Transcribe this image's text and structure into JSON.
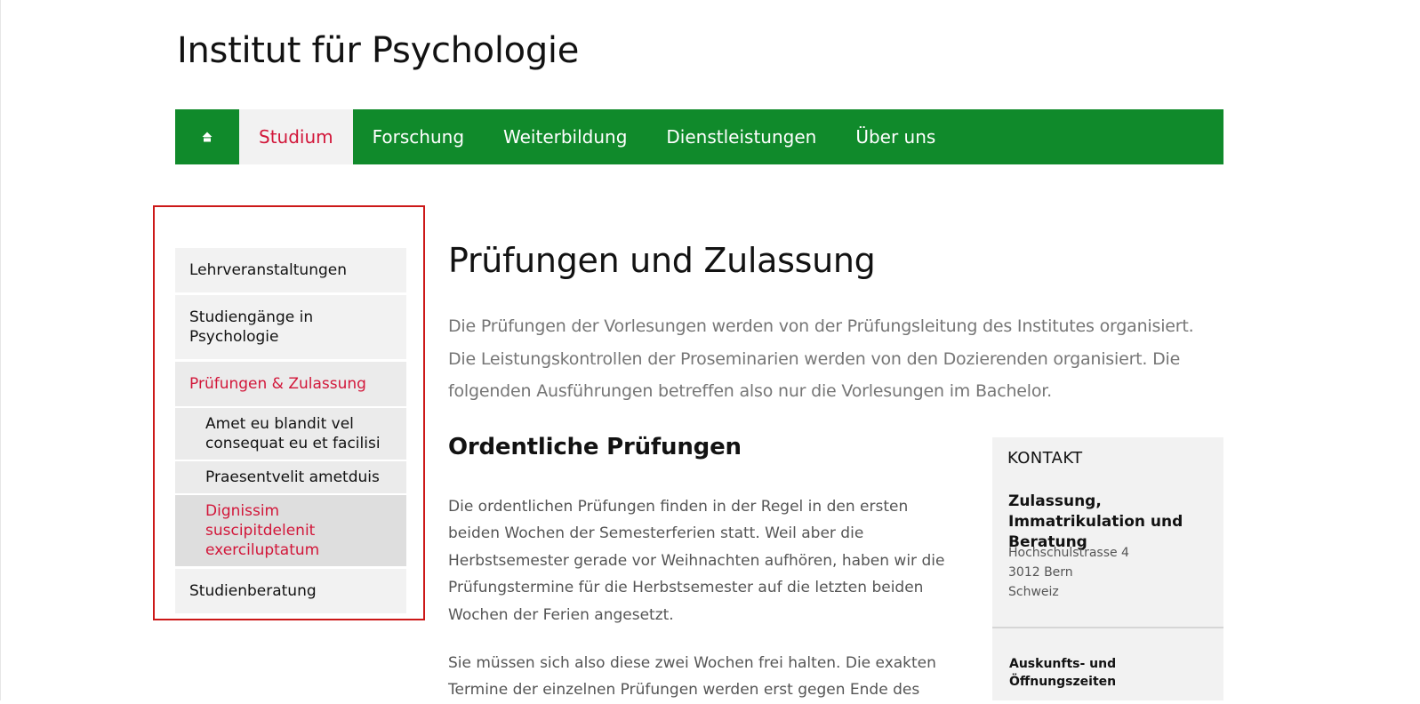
{
  "site": {
    "title": "Institut für Psychologie"
  },
  "main_nav": {
    "home_icon": "home-icon",
    "items": [
      {
        "label": "Studium",
        "active": true
      },
      {
        "label": "Forschung"
      },
      {
        "label": "Weiterbildung"
      },
      {
        "label": "Dienstleistungen"
      },
      {
        "label": "Über uns"
      }
    ]
  },
  "sidebar": {
    "items": [
      {
        "label": "Lehrveranstaltungen"
      },
      {
        "label": "Studiengänge in Psychologie"
      },
      {
        "label": "Prüfungen & Zulassung",
        "active": true
      },
      {
        "label": "Studienberatung"
      }
    ],
    "subitems": [
      {
        "label": "Amet eu blandit vel consequat eu et facilisi"
      },
      {
        "label": "Praesentvelit ametduis"
      },
      {
        "label": "Dignissim suscipitdelenit exerciluptatum",
        "active": true
      }
    ]
  },
  "main": {
    "title": "Prüfungen und Zulassung",
    "lead": "Die Prüfungen der Vorlesungen werden von der Prüfungsleitung des Institutes organisiert. Die Leistungskontrollen der Proseminarien werden von den Dozierenden organisiert. Die folgenden Ausführungen betreffen also nur die Vorlesungen im Bachelor.",
    "section_title": "Ordentliche Prüfungen",
    "paragraph_1": "Die ordentlichen Prüfungen finden in der Regel in den ersten beiden Wochen der Semesterferien statt. Weil aber die Herbstsemester gerade vor Weihnachten aufhören, haben wir die Prüfungstermine für die Herbstsemester auf die letzten beiden Wochen der Ferien angesetzt.",
    "paragraph_2": "Sie müssen sich also diese zwei Wochen frei halten. Die exakten Termine der einzelnen Prüfungen werden erst gegen Ende des"
  },
  "contact": {
    "heading": "KONTAKT",
    "org": "Zulassung, Immatrikulation und Beratung",
    "street": "Hochschulstrasse 4",
    "city": "3012 Bern",
    "country": "Schweiz",
    "hours_label": "Auskunfts- und Öffnungszeiten"
  },
  "colors": {
    "brand_green": "#108a2b",
    "accent_red": "#d2173a",
    "highlight_border": "#cc1818"
  }
}
